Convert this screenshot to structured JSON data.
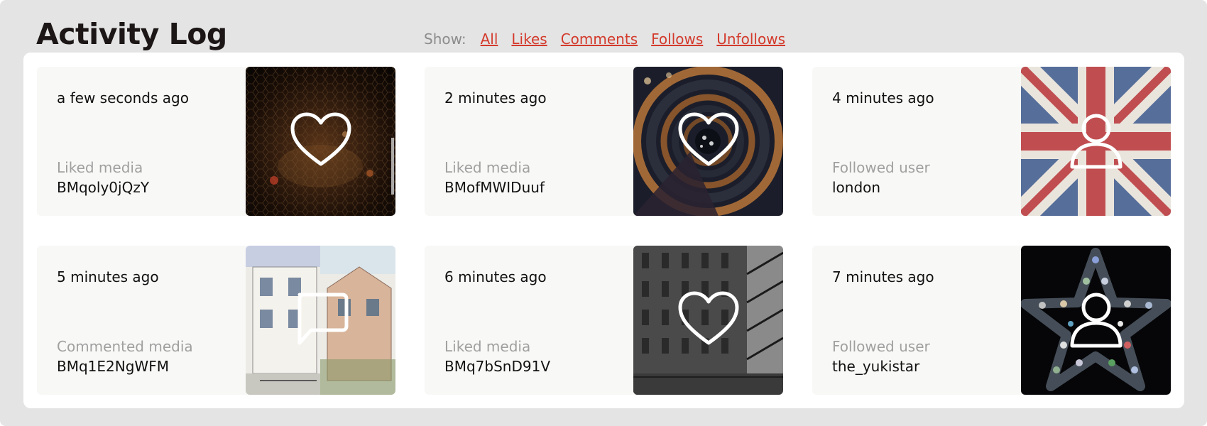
{
  "header": {
    "title": "Activity Log"
  },
  "filters": {
    "show_label": "Show:",
    "links": [
      "All",
      "Likes",
      "Comments",
      "Follows",
      "Unfollows"
    ]
  },
  "activities": [
    {
      "time": "a few seconds ago",
      "action": "Liked media",
      "target": "BMqoly0jQzY",
      "icon": "heart-icon",
      "image": "dark-hexagon-tunnel-photo"
    },
    {
      "time": "2 minutes ago",
      "action": "Liked media",
      "target": "BMofMWIDuuf",
      "icon": "heart-icon",
      "image": "spiral-staircase-photo"
    },
    {
      "time": "4 minutes ago",
      "action": "Followed user",
      "target": "london",
      "icon": "user-icon",
      "image": "union-jack-flag-photo"
    },
    {
      "time": "5 minutes ago",
      "action": "Commented media",
      "target": "BMq1E2NgWFM",
      "icon": "comment-icon",
      "image": "townhouse-sketch-photo"
    },
    {
      "time": "6 minutes ago",
      "action": "Liked media",
      "target": "BMq7bSnD91V",
      "icon": "heart-icon",
      "image": "brick-building-photo"
    },
    {
      "time": "7 minutes ago",
      "action": "Followed user",
      "target": "the_yukistar",
      "icon": "user-icon",
      "image": "jewel-star-photo"
    }
  ],
  "colors": {
    "link": "#d33a2c",
    "muted": "#a0a0a0",
    "frame": "#e4e4e4",
    "card": "#f8f8f6"
  }
}
